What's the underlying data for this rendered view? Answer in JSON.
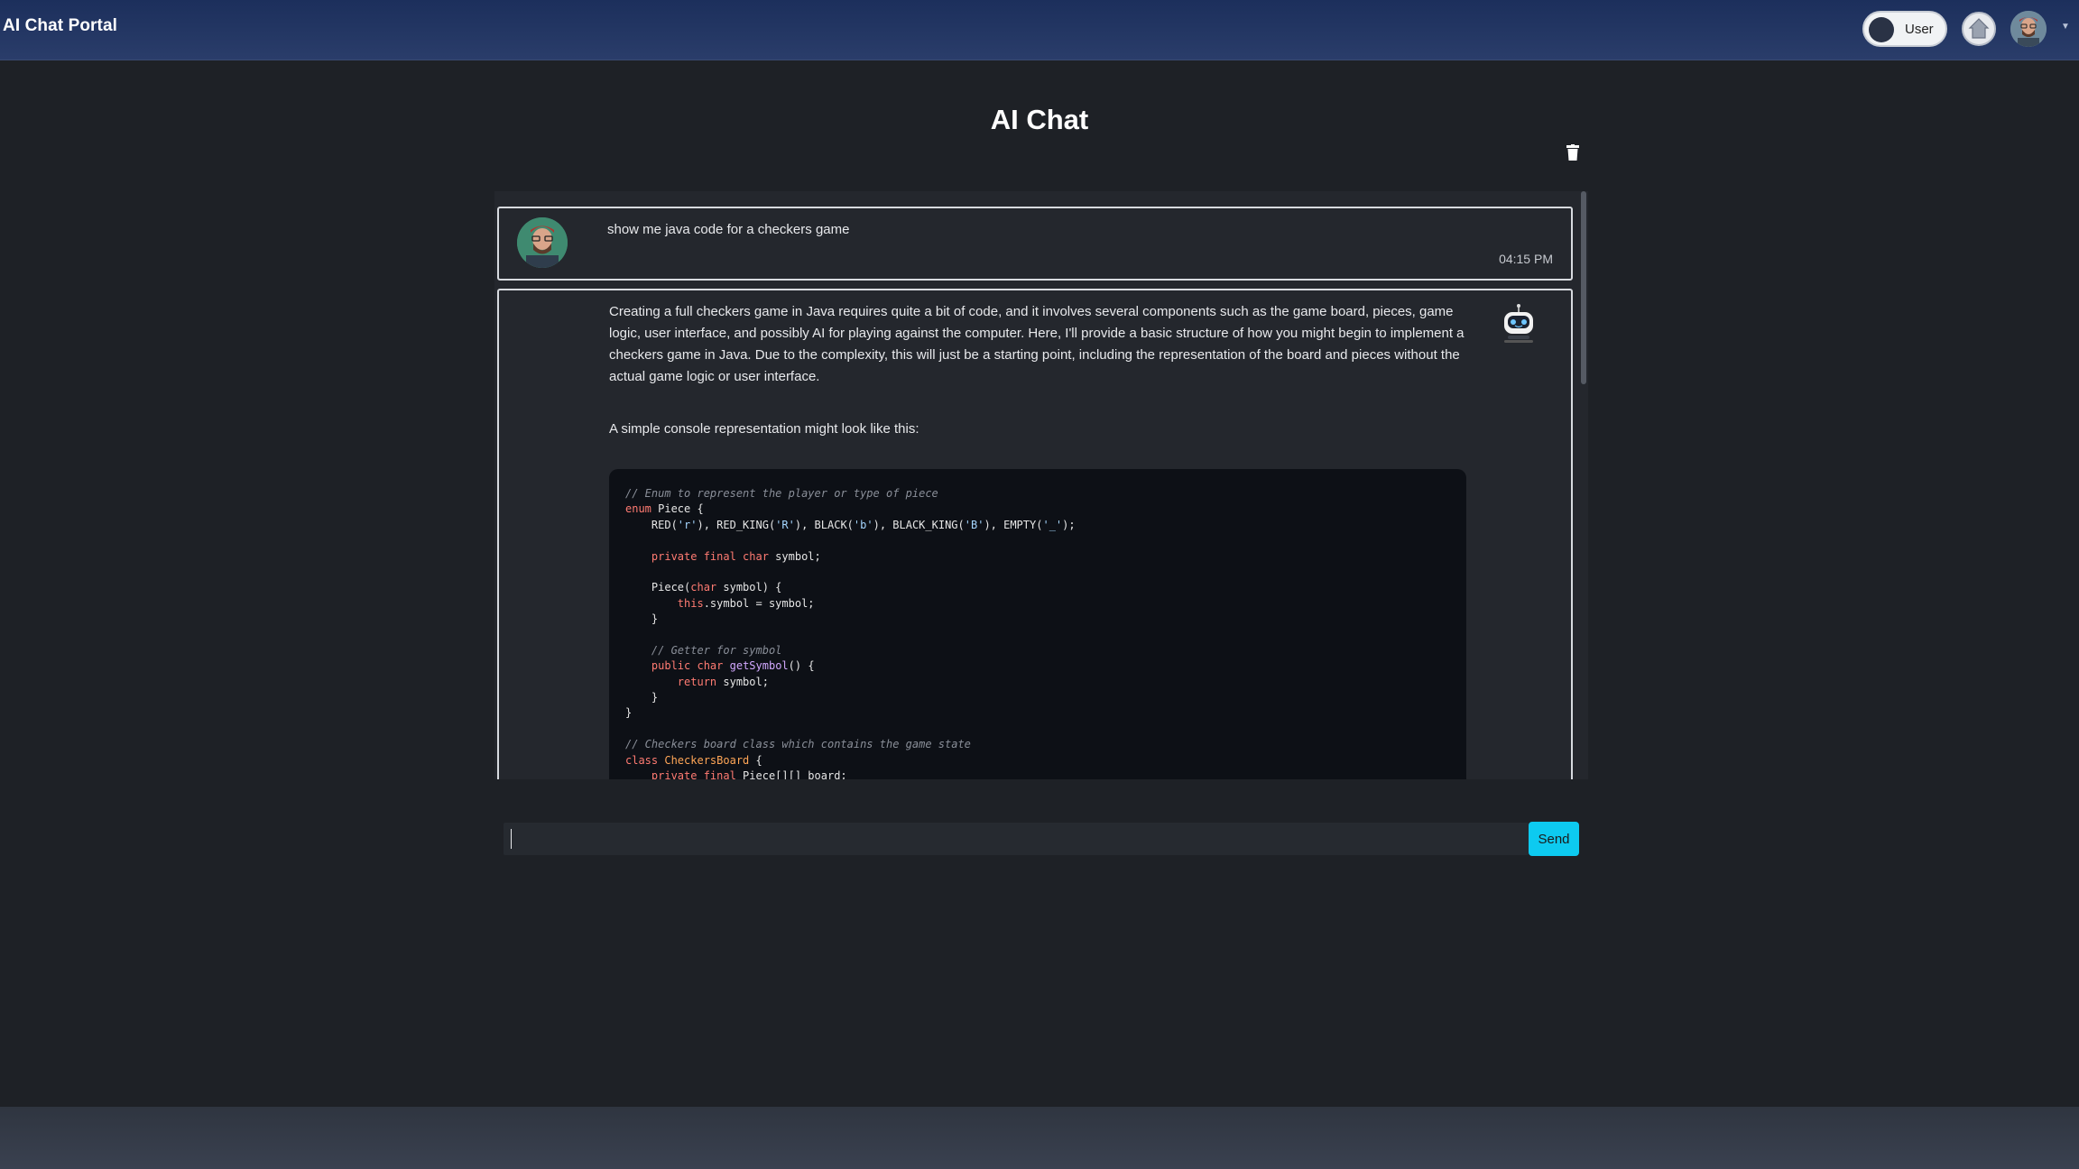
{
  "navbar": {
    "brand": "AI Chat Portal",
    "mode_toggle_label": "User"
  },
  "page": {
    "title": "AI Chat"
  },
  "messages": {
    "user": {
      "text": "show me java code for a checkers game",
      "time": "04:15 PM"
    },
    "bot": {
      "paragraphs": [
        "Creating a full checkers game in Java requires quite a bit of code, and it involves several components such as the game board, pieces, game logic, user interface, and possibly AI for playing against the computer. Here, I'll provide a basic structure of how you might begin to implement a checkers game in Java. Due to the complexity, this will just be a starting point, including the representation of the board and pieces without the actual game logic or user interface.",
        "A simple console representation might look like this:"
      ],
      "code_lines": [
        "// Enum to represent the player or type of piece",
        "enum Piece {",
        "    RED('r'), RED_KING('R'), BLACK('b'), BLACK_KING('B'), EMPTY('_');",
        "",
        "    private final char symbol;",
        "",
        "    Piece(char symbol) {",
        "        this.symbol = symbol;",
        "    }",
        "",
        "    // Getter for symbol",
        "    public char getSymbol() {",
        "        return symbol;",
        "    }",
        "}",
        "",
        "// Checkers board class which contains the game state",
        "class CheckersBoard {",
        "    private final Piece[][] board;"
      ]
    }
  },
  "composer": {
    "input_value": "",
    "send_label": "Send"
  },
  "icons": {
    "home": "home-icon",
    "trash": "trash-icon",
    "bot": "robot-icon"
  },
  "colors": {
    "accent": "#0dcaf0",
    "navbar": "#1c2f5c",
    "background": "#1e2126"
  }
}
